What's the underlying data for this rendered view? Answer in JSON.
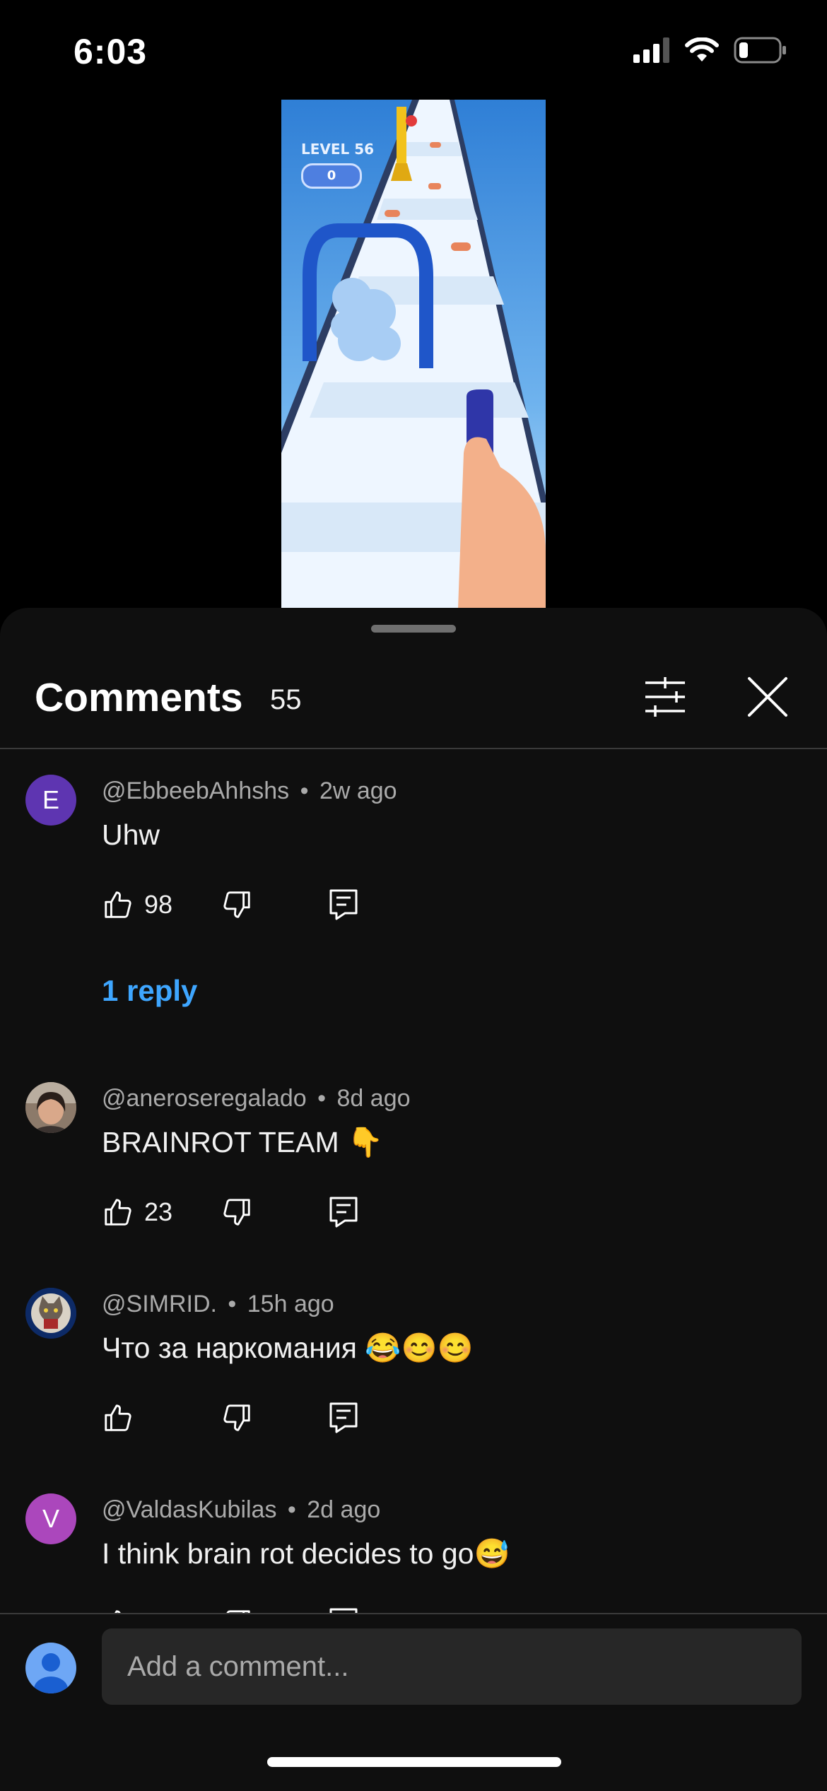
{
  "status": {
    "time": "6:03"
  },
  "video": {
    "level_label": "LEVEL 56",
    "score": "0"
  },
  "header": {
    "title": "Comments",
    "count": "55"
  },
  "icons": {
    "filter": "sliders-icon",
    "close": "close-icon",
    "like": "thumb-up-icon",
    "dislike": "thumb-down-icon",
    "reply": "comment-reply-icon"
  },
  "comments": [
    {
      "author": "@EbbeebAhhshs",
      "time": "2w ago",
      "text": "Uhw",
      "likes": "98",
      "avatar_letter": "E",
      "avatar_color": "#5e35b1",
      "replies": "1 reply"
    },
    {
      "author": "@aneroseregalado",
      "time": "8d ago",
      "text": "BRAINROT TEAM 👇",
      "likes": "23"
    },
    {
      "author": "@SIMRID.",
      "time": "15h ago",
      "text": "Что за наркомания 😂😊😊",
      "likes": ""
    },
    {
      "author": "@ValdasKubilas",
      "time": "2d ago",
      "text": "I think brain rot decides to go😅",
      "likes": "",
      "avatar_letter": "V",
      "avatar_color": "#ab47bc"
    }
  ],
  "compose": {
    "placeholder": "Add a comment..."
  },
  "colors": {
    "sheet_bg": "#0f0f0f",
    "link": "#3ea6ff",
    "muted": "#aaaaaa"
  }
}
